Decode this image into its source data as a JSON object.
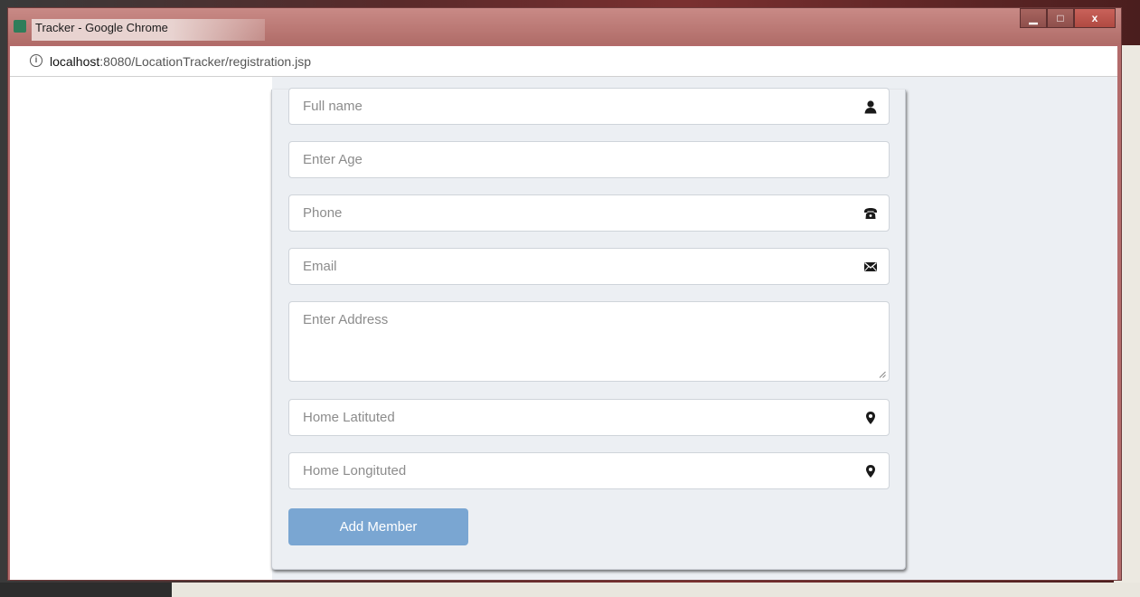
{
  "window": {
    "title": "Tracker - Google Chrome",
    "minimize": "▁",
    "maximize": "□",
    "close": "x"
  },
  "addressbar": {
    "host": "localhost",
    "path": ":8080/LocationTracker/registration.jsp"
  },
  "form": {
    "fullname_placeholder": "Full name",
    "age_placeholder": "Enter Age",
    "phone_placeholder": "Phone",
    "email_placeholder": "Email",
    "address_placeholder": "Enter Address",
    "latitude_placeholder": "Home Latituted",
    "longitude_placeholder": "Home Longituted",
    "submit_label": "Add Member"
  },
  "colors": {
    "button": "#7aa6d2",
    "panel": "#eceff3"
  },
  "icons": {
    "fullname": "user-icon",
    "phone": "phone-icon",
    "email": "envelope-icon",
    "latitude": "map-marker-icon",
    "longitude": "map-marker-icon"
  }
}
